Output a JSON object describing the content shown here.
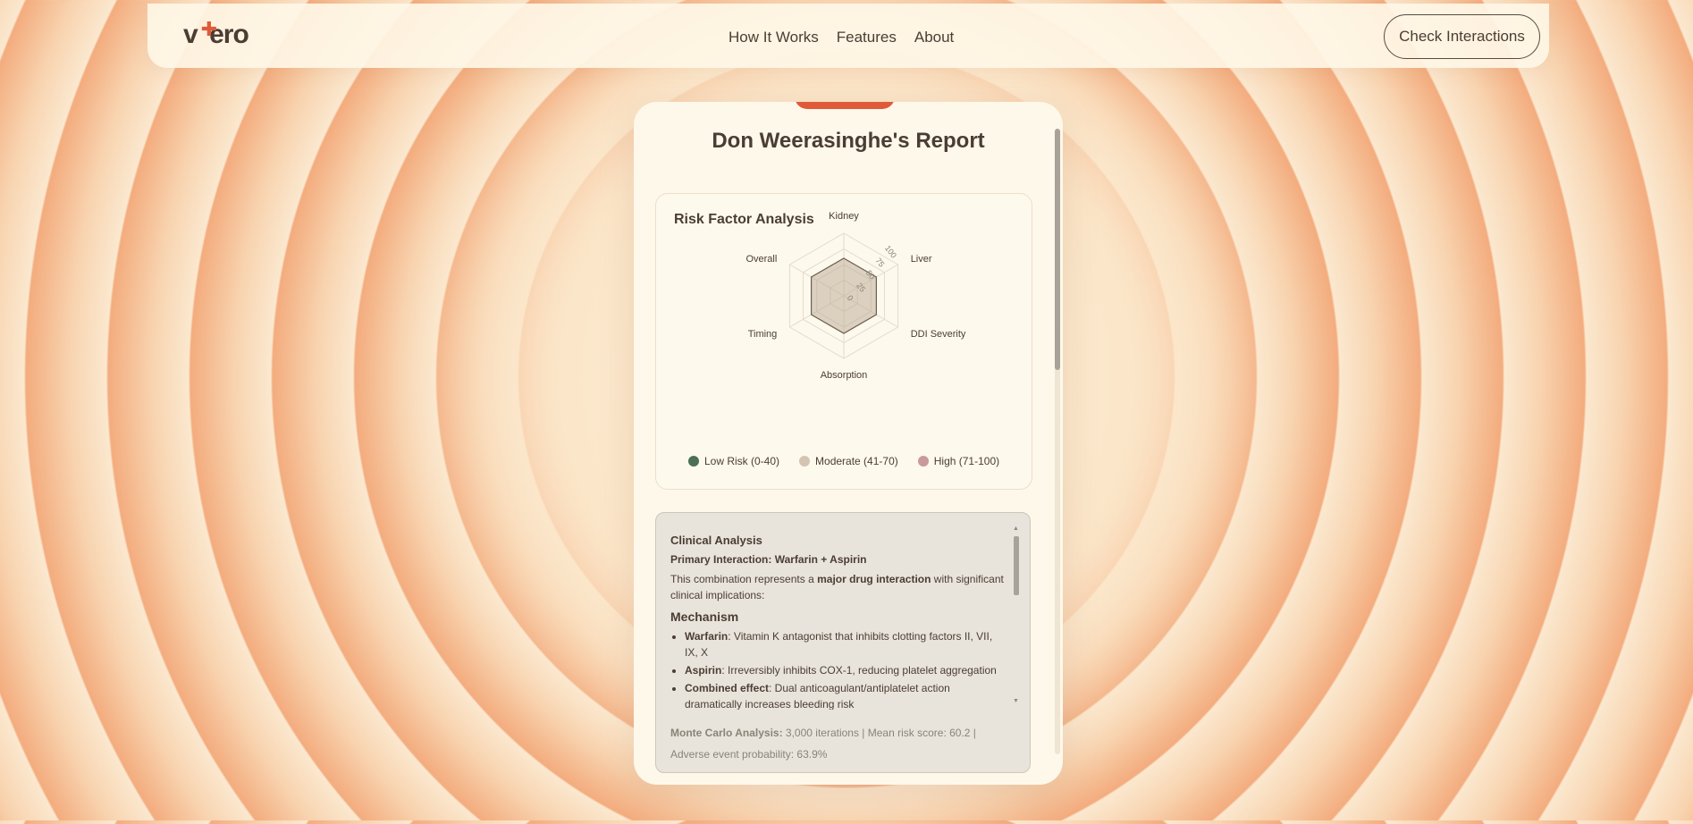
{
  "nav": {
    "logo": "vero",
    "links": [
      "How It Works",
      "Features",
      "About"
    ],
    "cta": "Check Interactions"
  },
  "report": {
    "title": "Don Weerasinghe's Report"
  },
  "risk_panel": {
    "title": "Risk Factor Analysis",
    "chart_data": {
      "type": "radar",
      "axes": [
        "Kidney",
        "Liver",
        "DDI Severity",
        "Absorption",
        "Timing",
        "Overall"
      ],
      "values": [
        60,
        60,
        60,
        60,
        60,
        60
      ],
      "rlim": [
        0,
        100
      ],
      "ticks": [
        "0",
        "25",
        "50",
        "75",
        "100"
      ],
      "grid": true
    },
    "legend": [
      {
        "label": "Low Risk (0-40)",
        "color": "#4c6f55"
      },
      {
        "label": "Moderate (41-70)",
        "color": "#d4c5b3"
      },
      {
        "label": "High (71-100)",
        "color": "#c99a9a"
      }
    ]
  },
  "clinical": {
    "title": "Clinical Analysis",
    "primary": "Primary Interaction: Warfarin + Aspirin",
    "intro_pre": "This combination represents a ",
    "intro_bold": "major drug interaction",
    "intro_post": " with significant clinical implications:",
    "mechanism_heading": "Mechanism",
    "mechanism": [
      {
        "term": "Warfarin",
        "text": ": Vitamin K antagonist that inhibits clotting factors II, VII, IX, X"
      },
      {
        "term": "Aspirin",
        "text": ": Irreversibly inhibits COX-1, reducing platelet aggregation"
      },
      {
        "term": "Combined effect",
        "text": ": Dual anticoagulant/antiplatelet action dramatically increases bleeding risk"
      }
    ],
    "monte_carlo_label": "Monte Carlo Analysis:",
    "monte_carlo_text": " 3,000 iterations | Mean risk score: 60.2 | Adverse event probability: 63.9%"
  }
}
